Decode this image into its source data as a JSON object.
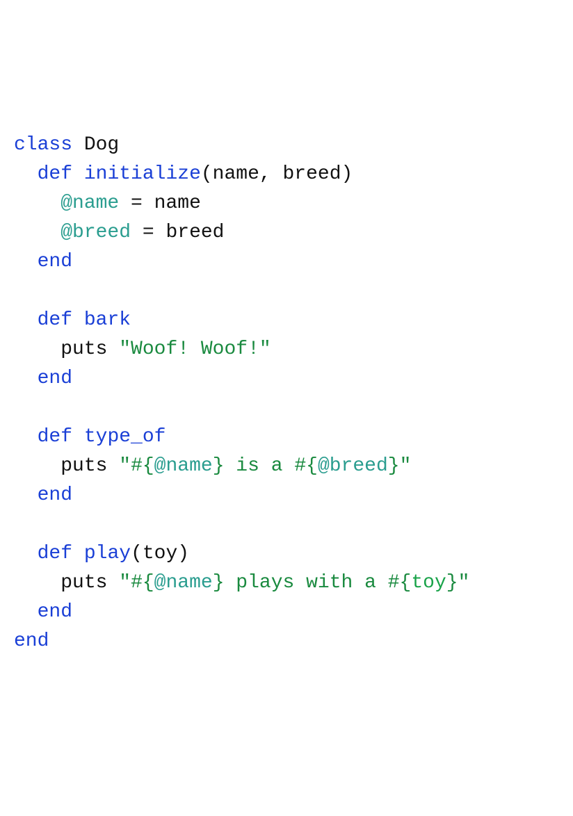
{
  "code": {
    "keywords": {
      "class": "class",
      "def": "def",
      "end": "end"
    },
    "class_name": "Dog",
    "methods": {
      "initialize": {
        "name": "initialize",
        "params": "(name, breed)",
        "body": {
          "line1_ivar": "@name",
          "line1_op": " = ",
          "line1_val": "name",
          "line2_ivar": "@breed",
          "line2_op": " = ",
          "line2_val": "breed"
        }
      },
      "bark": {
        "name": "bark",
        "body": {
          "fn": "puts",
          "str": "\"Woof! Woof!\""
        }
      },
      "type_of": {
        "name": "type_of",
        "body": {
          "fn": "puts",
          "str_q1": "\"",
          "interp1_open": "#{",
          "interp1_var": "@name",
          "interp1_close": "}",
          "str_mid": " is a ",
          "interp2_open": "#{",
          "interp2_var": "@breed",
          "interp2_close": "}",
          "str_q2": "\""
        }
      },
      "play": {
        "name": "play",
        "params": "(toy)",
        "body": {
          "fn": "puts",
          "str_q1": "\"",
          "interp1_open": "#{",
          "interp1_var": "@name",
          "interp1_close": "}",
          "str_mid": " plays with a ",
          "interp2_open": "#{",
          "interp2_var": "toy",
          "interp2_close": "}",
          "str_q2": "\""
        }
      }
    }
  }
}
